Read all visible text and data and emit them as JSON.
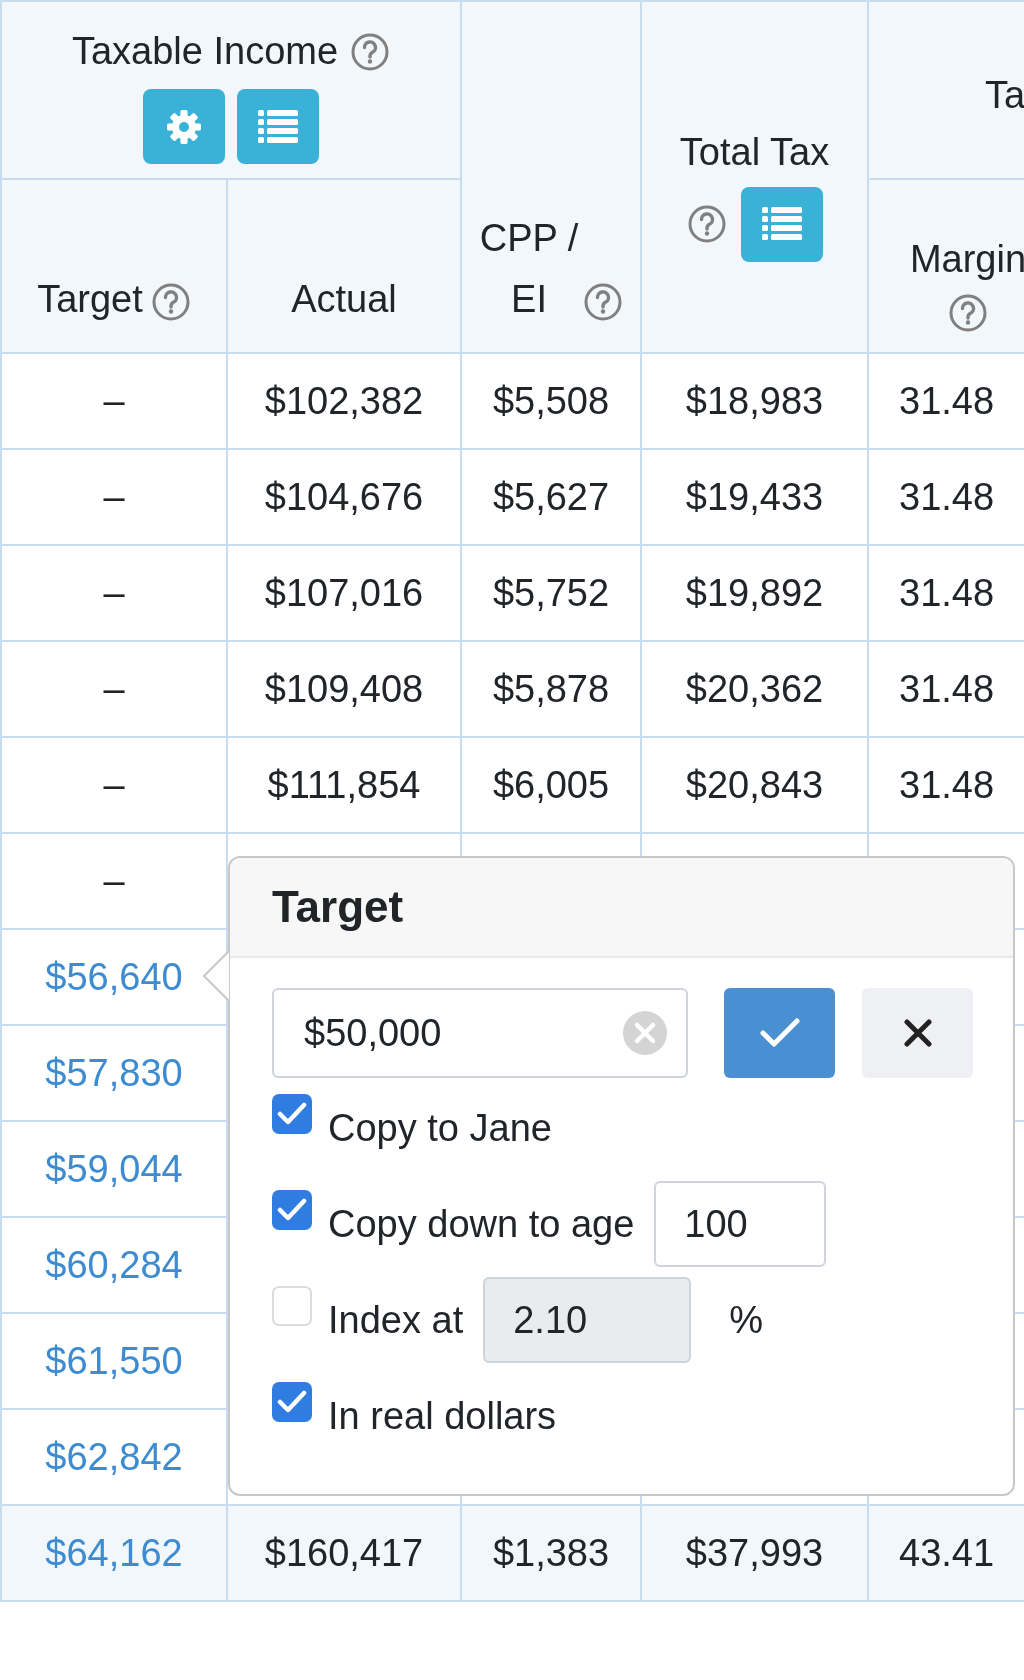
{
  "table": {
    "header_group": {
      "label": "Taxable Income",
      "help": true
    },
    "cut_group_header": "Ta",
    "columns": [
      {
        "label": "Target",
        "help": true,
        "list_button": false
      },
      {
        "label": "Actual",
        "help": false,
        "list_button": false
      },
      {
        "label": "CPP / EI",
        "help": true,
        "list_button": false
      },
      {
        "label": "Total Tax",
        "help": true,
        "list_button": true
      },
      {
        "label": "Margin",
        "help": true,
        "list_button": false
      }
    ],
    "rows": [
      {
        "highlighted": false,
        "target": {
          "kind": "dash",
          "text": "–"
        },
        "cells": [
          "$102,382",
          "$5,508",
          "$18,983",
          "31.48"
        ]
      },
      {
        "highlighted": false,
        "target": {
          "kind": "dash",
          "text": "–"
        },
        "cells": [
          "$104,676",
          "$5,627",
          "$19,433",
          "31.48"
        ]
      },
      {
        "highlighted": false,
        "target": {
          "kind": "dash",
          "text": "–"
        },
        "cells": [
          "$107,016",
          "$5,752",
          "$19,892",
          "31.48"
        ]
      },
      {
        "highlighted": false,
        "target": {
          "kind": "dash",
          "text": "–"
        },
        "cells": [
          "$109,408",
          "$5,878",
          "$20,362",
          "31.48"
        ]
      },
      {
        "highlighted": false,
        "target": {
          "kind": "dash",
          "text": "–"
        },
        "cells": [
          "$111,854",
          "$6,005",
          "$20,843",
          "31.48"
        ]
      },
      {
        "highlighted": false,
        "target": {
          "kind": "dash",
          "text": "–"
        }
      },
      {
        "highlighted": false,
        "target": {
          "kind": "link",
          "text": "$56,640"
        }
      },
      {
        "highlighted": false,
        "target": {
          "kind": "link",
          "text": "$57,830"
        }
      },
      {
        "highlighted": false,
        "target": {
          "kind": "link",
          "text": "$59,044"
        }
      },
      {
        "highlighted": false,
        "target": {
          "kind": "link",
          "text": "$60,284"
        }
      },
      {
        "highlighted": false,
        "target": {
          "kind": "link",
          "text": "$61,550"
        }
      },
      {
        "highlighted": false,
        "target": {
          "kind": "link",
          "text": "$62,842"
        }
      },
      {
        "highlighted": true,
        "target": {
          "kind": "link",
          "text": "$64,162"
        },
        "cells": [
          "$160,417",
          "$1,383",
          "$37,993",
          "43.41"
        ]
      }
    ]
  },
  "popover": {
    "title": "Target",
    "value": "$50,000",
    "options": [
      {
        "kind": "checkbox",
        "label": "Copy to Jane",
        "checked": true
      },
      {
        "kind": "number",
        "label": "Copy down to age",
        "checked": true,
        "value": "100",
        "disabled": false
      },
      {
        "kind": "percent",
        "label": "Index at",
        "checked": false,
        "value": "2.10",
        "disabled": true,
        "unit": "%"
      },
      {
        "kind": "checkbox",
        "label": "In real dollars",
        "checked": true
      }
    ]
  }
}
